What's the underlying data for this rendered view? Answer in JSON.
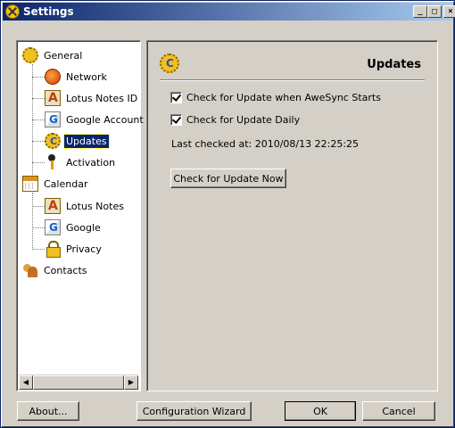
{
  "window": {
    "title": "Settings"
  },
  "tree": {
    "items": [
      {
        "label": "General",
        "icon": "gear-icon",
        "level": 0
      },
      {
        "label": "Network",
        "icon": "globe-icon",
        "level": 1
      },
      {
        "label": "Lotus Notes ID",
        "icon": "lotus-notes-icon",
        "level": 1
      },
      {
        "label": "Google Account",
        "icon": "google-icon",
        "level": 1
      },
      {
        "label": "Updates",
        "icon": "update-icon",
        "level": 1,
        "selected": true
      },
      {
        "label": "Activation",
        "icon": "activation-icon",
        "level": 1
      },
      {
        "label": "Calendar",
        "icon": "calendar-icon",
        "level": 0
      },
      {
        "label": "Lotus Notes",
        "icon": "lotus-notes-icon",
        "level": 1
      },
      {
        "label": "Google",
        "icon": "google-icon",
        "level": 1
      },
      {
        "label": "Privacy",
        "icon": "lock-icon",
        "level": 1
      },
      {
        "label": "Contacts",
        "icon": "contacts-icon",
        "level": 0
      }
    ]
  },
  "updates": {
    "title": "Updates",
    "check_on_start_label": "Check for Update when AweSync Starts",
    "check_on_start_checked": true,
    "check_daily_label": "Check for Update Daily",
    "check_daily_checked": true,
    "last_checked": "Last checked at: 2010/08/13 22:25:25",
    "check_now_label": "Check for Update Now"
  },
  "footer": {
    "about_label": "About...",
    "wizard_label": "Configuration Wizard",
    "ok_label": "OK",
    "cancel_label": "Cancel"
  },
  "colors": {
    "titlebar_start": "#0a246a",
    "titlebar_end": "#a6caf0",
    "selection": "#0a246a",
    "face": "#d4d0c8"
  }
}
